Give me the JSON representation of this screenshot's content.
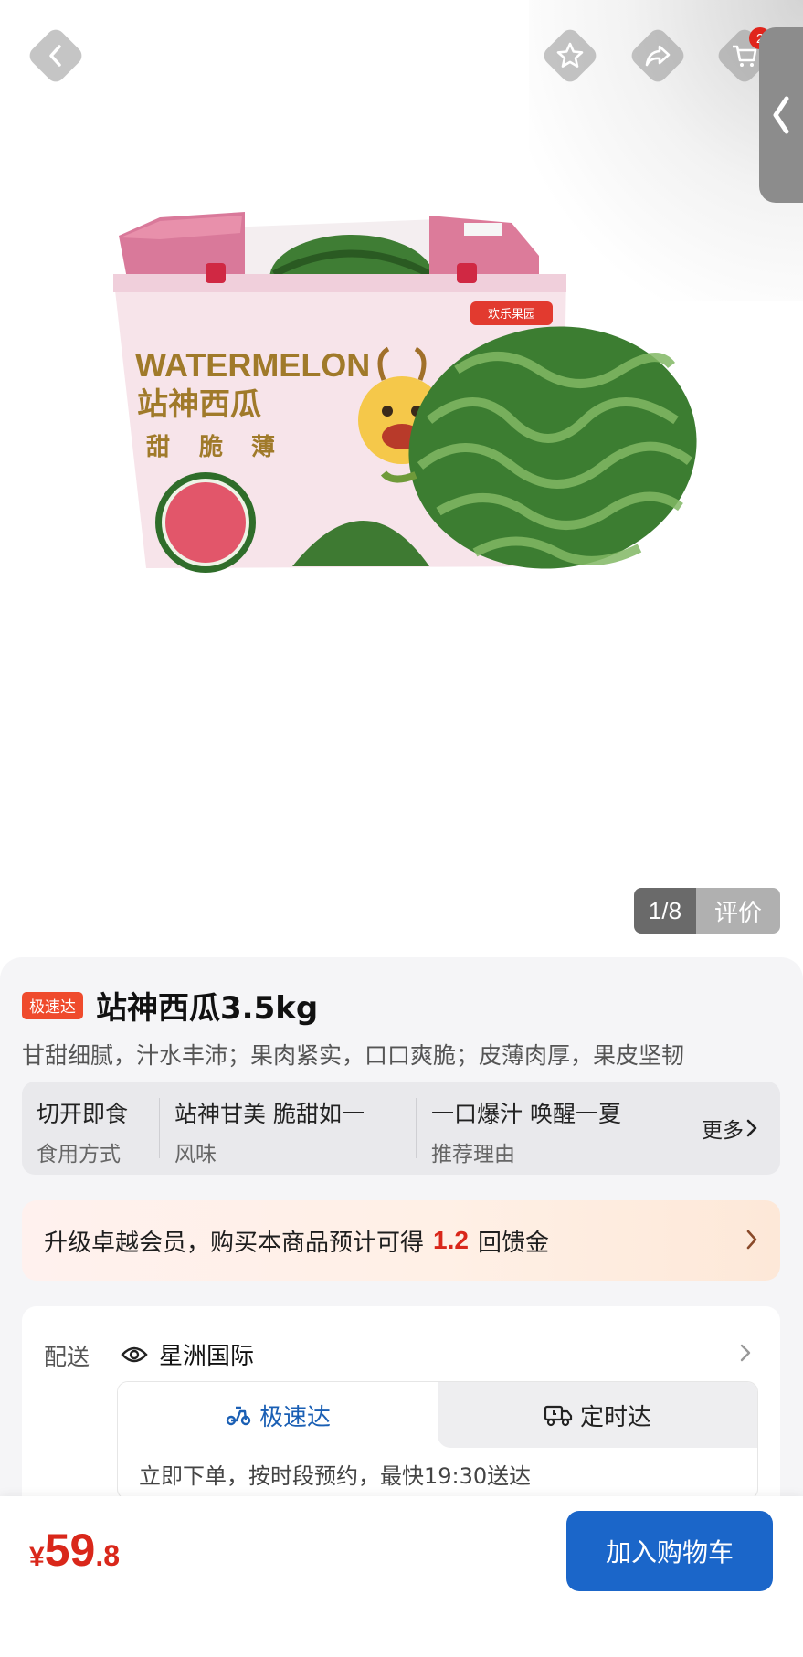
{
  "header": {
    "icons": [
      "back-icon",
      "star-icon",
      "share-icon",
      "cart-icon"
    ],
    "cart_badge": "2"
  },
  "hero": {
    "box_text_en": "WATERMELON",
    "box_text_cn": "站神西瓜",
    "box_features": [
      "甜",
      "脆",
      "薄"
    ],
    "box_brand": "欢乐果园",
    "image_counter": "1/8",
    "review_label": "评价"
  },
  "product": {
    "tag": "极速达",
    "title": "站神西瓜3.5kg",
    "subtitle": "甘甜细腻，汁水丰沛；果肉紧实，口口爽脆；皮薄肉厚，果皮坚韧",
    "attributes": [
      {
        "value": "切开即食",
        "key": "食用方式"
      },
      {
        "value": "站神甘美 脆甜如一",
        "key": "风味"
      },
      {
        "value": "一口爆汁 唤醒一夏",
        "key": "推荐理由"
      }
    ],
    "more_label": "更多"
  },
  "promo": {
    "text_before": "升级卓越会员，购买本商品预计可得",
    "amount": "1.2",
    "text_after": "回馈金"
  },
  "delivery": {
    "label": "配送",
    "location": "星洲国际",
    "tabs": [
      {
        "label": "极速达",
        "active": true
      },
      {
        "label": "定时达",
        "active": false
      }
    ],
    "description": "立即下单，按时段预约，最快19:30送达"
  },
  "bottom": {
    "currency": "¥",
    "price_int": "59",
    "price_dec": ".8",
    "add_to_cart": "加入购物车"
  },
  "colors": {
    "price_red": "#d9271a",
    "primary_blue": "#1b66c9",
    "tag_orange": "#ef4b2d"
  }
}
